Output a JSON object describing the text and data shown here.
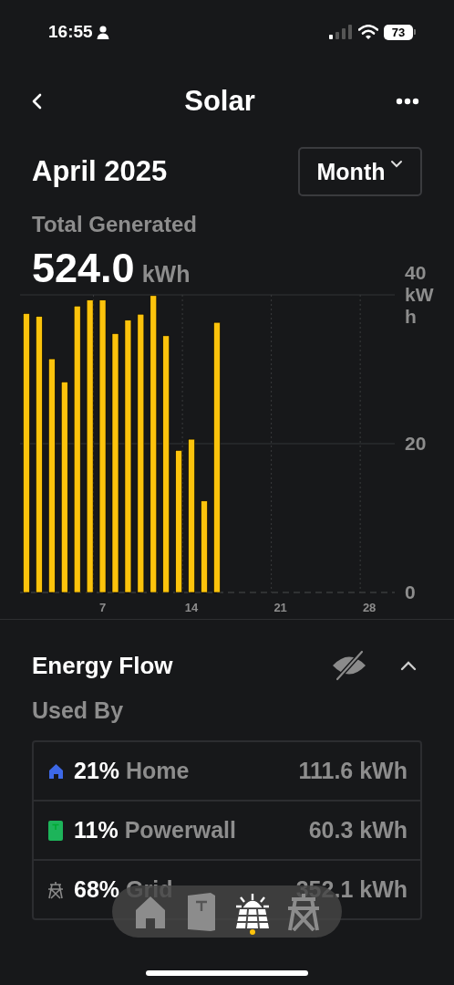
{
  "status_bar": {
    "time": "16:55",
    "battery": "73"
  },
  "nav": {
    "title": "Solar"
  },
  "period": {
    "title": "April 2025",
    "dropdown": "Month"
  },
  "total": {
    "label": "Total Generated",
    "value": "524.0",
    "unit": "kWh"
  },
  "chart_data": {
    "type": "bar",
    "x": [
      1,
      2,
      3,
      4,
      5,
      6,
      7,
      8,
      9,
      10,
      11,
      12,
      13,
      14,
      15,
      16
    ],
    "series": [
      {
        "color": "#fcc30c",
        "values": [
          37.5,
          37.1,
          31.4,
          28.3,
          38.5,
          39.3,
          39.3,
          34.8,
          36.6,
          37.4,
          39.9,
          34.5,
          19.1,
          20.6,
          12.3,
          36.3
        ]
      }
    ],
    "xlim": [
      0.5,
      30
    ],
    "ylim": [
      0,
      40
    ],
    "xticks": [
      7,
      14,
      21,
      28
    ],
    "yticks": [
      0,
      20,
      {
        "value": 40,
        "label": "40 kWh"
      }
    ]
  },
  "energy_flow": {
    "title": "Energy Flow",
    "subtitle": "Used By",
    "expanded": true,
    "rows": [
      {
        "kind": "home",
        "color": "#3d68e6",
        "percent": "21%",
        "label": "Home",
        "value": "111.6 kWh"
      },
      {
        "kind": "powerwall",
        "color": "#1db45a",
        "percent": "11%",
        "label": "Powerwall",
        "value": "60.3 kWh"
      },
      {
        "kind": "grid",
        "color": "#8a8a8a",
        "percent": "68%",
        "label": "Grid",
        "value": "352.1 kWh"
      }
    ]
  },
  "tabs": [
    {
      "kind": "home",
      "selected": false
    },
    {
      "kind": "powerwall",
      "selected": false
    },
    {
      "kind": "solar",
      "selected": true
    },
    {
      "kind": "grid",
      "selected": false
    }
  ]
}
